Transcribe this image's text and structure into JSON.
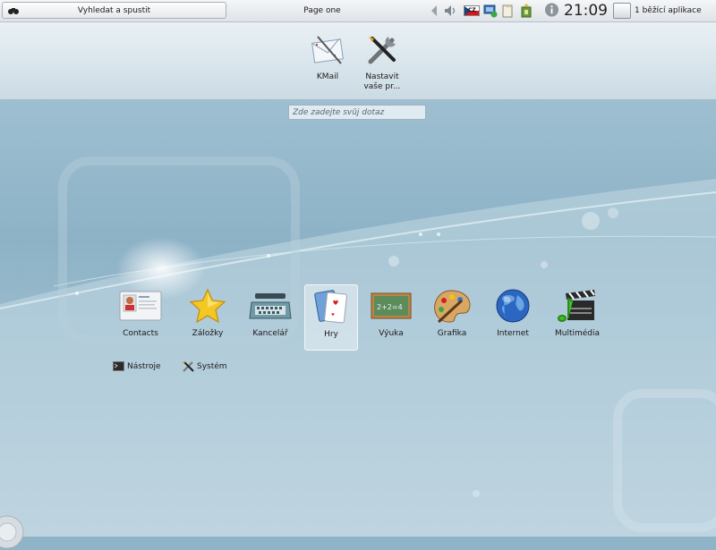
{
  "panel": {
    "launcher_label": "Vyhledat a spustit",
    "page_label": "Page one",
    "keyboard_layout": "CZ",
    "clock": "21:09",
    "running_apps": "1 běžící aplikace"
  },
  "favorites": [
    {
      "label": "KMail",
      "icon": "mail-icon"
    },
    {
      "label": "Nastavit vaše pr...",
      "icon": "tools-icon"
    }
  ],
  "search": {
    "placeholder": "Zde zadejte svůj dotaz"
  },
  "categories": [
    {
      "label": "Contacts",
      "icon": "contacts-icon"
    },
    {
      "label": "Záložky",
      "icon": "star-icon"
    },
    {
      "label": "Kancelář",
      "icon": "typewriter-icon"
    },
    {
      "label": "Hry",
      "icon": "cards-icon",
      "selected": true
    },
    {
      "label": "Výuka",
      "icon": "chalkboard-icon"
    },
    {
      "label": "Grafika",
      "icon": "palette-icon"
    },
    {
      "label": "Internet",
      "icon": "globe-icon"
    },
    {
      "label": "Multimédia",
      "icon": "clapperboard-icon"
    }
  ],
  "subcategories": [
    {
      "label": "Nástroje",
      "icon": "terminal-icon"
    },
    {
      "label": "Systém",
      "icon": "system-tools-icon"
    }
  ],
  "colors": {
    "accent": "#3a78c4",
    "panel": "#e6e9ec",
    "background": "#8fb3c7"
  }
}
